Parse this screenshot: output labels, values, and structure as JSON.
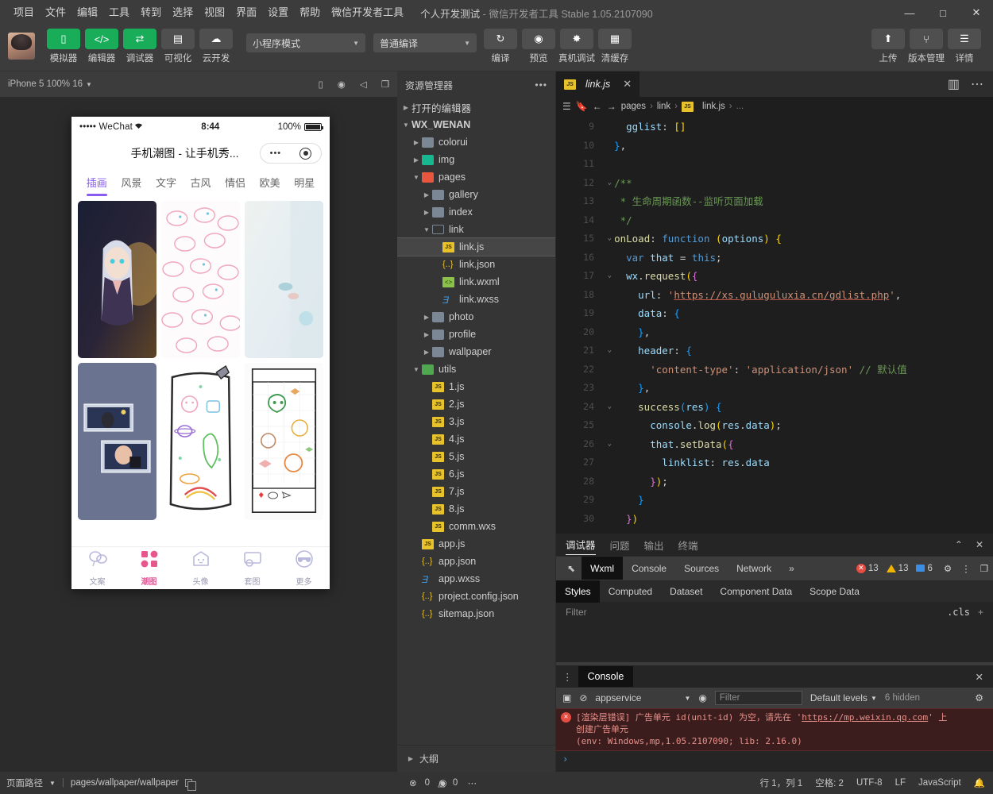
{
  "titlebar": {
    "menus": [
      "项目",
      "文件",
      "编辑",
      "工具",
      "转到",
      "选择",
      "视图",
      "界面",
      "设置",
      "帮助",
      "微信开发者工具"
    ],
    "project": "个人开发测试",
    "dash": "-",
    "app": "微信开发者工具",
    "version": "Stable 1.05.2107090",
    "minimize": "—",
    "maximize": "□",
    "close": "✕"
  },
  "toolbar": {
    "buttons": [
      {
        "label": "模拟器",
        "icon": "phone-icon",
        "style": "green"
      },
      {
        "label": "编辑器",
        "icon": "code-icon",
        "style": "green"
      },
      {
        "label": "调试器",
        "icon": "sliders-icon",
        "style": "green"
      },
      {
        "label": "可视化",
        "icon": "layout-icon",
        "style": "grey"
      },
      {
        "label": "云开发",
        "icon": "cloud-icon",
        "style": "grey"
      }
    ],
    "mode_select": "小程序模式",
    "compile_select": "普通编译",
    "actions": [
      {
        "label": "编译",
        "icon": "refresh-icon"
      },
      {
        "label": "预览",
        "icon": "eye-icon"
      },
      {
        "label": "真机调试",
        "icon": "bug-icon"
      },
      {
        "label": "清缓存",
        "icon": "layers-icon"
      }
    ],
    "right_actions": [
      {
        "label": "上传",
        "icon": "upload-icon"
      },
      {
        "label": "版本管理",
        "icon": "branch-icon"
      },
      {
        "label": "详情",
        "icon": "menu-icon"
      }
    ]
  },
  "simbar": {
    "device": "iPhone 5 100% 16",
    "icons": [
      "phone-rotate-icon",
      "record-icon",
      "volume-icon",
      "window-icon"
    ]
  },
  "editor_icons": [
    "copy-icon",
    "search-icon",
    "branch-icon",
    "extensions-icon",
    "debug-icon",
    "collapse-icon"
  ],
  "phone": {
    "carrier": "••••• WeChat",
    "wifi": "⌃",
    "time": "8:44",
    "percent": "100%",
    "nav_title": "手机潮图 - 让手机秀...",
    "capsule_dots": "•••",
    "tabs": [
      "插画",
      "风景",
      "文字",
      "古风",
      "情侣",
      "欧美",
      "明星"
    ],
    "active_tab": "插画",
    "tabbar": [
      {
        "label": "文案",
        "icon": "balloon-icon",
        "active": false
      },
      {
        "label": "潮图",
        "icon": "grid-icon",
        "active": true
      },
      {
        "label": "头像",
        "icon": "ghost-icon",
        "active": false
      },
      {
        "label": "套图",
        "icon": "album-icon",
        "active": false
      },
      {
        "label": "更多",
        "icon": "sunglasses-icon",
        "active": false
      }
    ]
  },
  "explorer": {
    "title": "资源管理器",
    "more": "•••",
    "open_editors": "打开的编辑器",
    "root": "WX_WENAN",
    "outline": "大纲",
    "tree": [
      {
        "name": "colorui",
        "type": "folder",
        "depth": 1,
        "expanded": false
      },
      {
        "name": "img",
        "type": "folder-img",
        "depth": 1,
        "expanded": false
      },
      {
        "name": "pages",
        "type": "folder-pages",
        "depth": 1,
        "expanded": true
      },
      {
        "name": "gallery",
        "type": "folder",
        "depth": 2,
        "expanded": false
      },
      {
        "name": "index",
        "type": "folder",
        "depth": 2,
        "expanded": false
      },
      {
        "name": "link",
        "type": "folder-open",
        "depth": 2,
        "expanded": true
      },
      {
        "name": "link.js",
        "type": "js",
        "depth": 3,
        "selected": true
      },
      {
        "name": "link.json",
        "type": "json",
        "depth": 3
      },
      {
        "name": "link.wxml",
        "type": "wxml",
        "depth": 3
      },
      {
        "name": "link.wxss",
        "type": "wxss",
        "depth": 3
      },
      {
        "name": "photo",
        "type": "folder",
        "depth": 2,
        "expanded": false
      },
      {
        "name": "profile",
        "type": "folder",
        "depth": 2,
        "expanded": false
      },
      {
        "name": "wallpaper",
        "type": "folder",
        "depth": 2,
        "expanded": false
      },
      {
        "name": "utils",
        "type": "folder-utils",
        "depth": 1,
        "expanded": true
      },
      {
        "name": "1.js",
        "type": "js",
        "depth": 2
      },
      {
        "name": "2.js",
        "type": "js",
        "depth": 2
      },
      {
        "name": "3.js",
        "type": "js",
        "depth": 2
      },
      {
        "name": "4.js",
        "type": "js",
        "depth": 2
      },
      {
        "name": "5.js",
        "type": "js",
        "depth": 2
      },
      {
        "name": "6.js",
        "type": "js",
        "depth": 2
      },
      {
        "name": "7.js",
        "type": "js",
        "depth": 2
      },
      {
        "name": "8.js",
        "type": "js",
        "depth": 2
      },
      {
        "name": "comm.wxs",
        "type": "js",
        "depth": 2
      },
      {
        "name": "app.js",
        "type": "js",
        "depth": 1
      },
      {
        "name": "app.json",
        "type": "json",
        "depth": 1
      },
      {
        "name": "app.wxss",
        "type": "wxss",
        "depth": 1
      },
      {
        "name": "project.config.json",
        "type": "json",
        "depth": 1
      },
      {
        "name": "sitemap.json",
        "type": "json",
        "depth": 1
      }
    ]
  },
  "editor": {
    "tab_label": "link.js",
    "tab_close": "✕",
    "breadcrumb": [
      "pages",
      "link",
      "link.js",
      "..."
    ],
    "right_icons": [
      "split-editor-icon",
      "more-actions-icon"
    ],
    "first_line_number": 9,
    "lines": [
      {
        "num": 9,
        "fold": false,
        "html": "    <span class='k-key'>gglist</span><span class='k-plain'>: </span><span class='k-br'>[]</span>"
      },
      {
        "num": 10,
        "fold": false,
        "html": "  <span class='k-br3'>}</span><span class='k-plain'>,</span>"
      },
      {
        "num": 11,
        "fold": false,
        "html": ""
      },
      {
        "num": 12,
        "fold": true,
        "html": "  <span class='k-com'>/**</span>"
      },
      {
        "num": 13,
        "fold": false,
        "html": "  <span class='k-com'> * 生命周期函数--监听页面加载</span>"
      },
      {
        "num": 14,
        "fold": false,
        "html": "  <span class='k-com'> */</span>"
      },
      {
        "num": 15,
        "fold": true,
        "html": "  <span class='k-fn'>onLoad</span><span class='k-plain'>: </span><span class='k-blue'>function</span> <span class='k-br'>(</span><span class='k-param'>options</span><span class='k-br'>)</span> <span class='k-br'>{</span>"
      },
      {
        "num": 16,
        "fold": false,
        "html": "    <span class='k-blue'>var</span> <span class='k-key'>that</span> <span class='k-plain'>=</span> <span class='k-blue'>this</span><span class='k-plain'>;</span>"
      },
      {
        "num": 17,
        "fold": true,
        "html": "    <span class='k-key'>wx</span><span class='k-plain'>.</span><span class='k-fn'>request</span><span class='k-br'>(</span><span class='k-br2'>{</span>"
      },
      {
        "num": 18,
        "fold": false,
        "html": "      <span class='k-key'>url</span><span class='k-plain'>: </span><span class='k-str'>'</span><span class='k-url'>https://xs.guluguluxia.cn/gdlist.php</span><span class='k-str'>'</span><span class='k-plain'>,</span>"
      },
      {
        "num": 19,
        "fold": false,
        "html": "      <span class='k-key'>data</span><span class='k-plain'>: </span><span class='k-br3'>{</span>"
      },
      {
        "num": 20,
        "fold": false,
        "html": "      <span class='k-br3'>}</span><span class='k-plain'>,</span>"
      },
      {
        "num": 21,
        "fold": true,
        "html": "      <span class='k-key'>header</span><span class='k-plain'>: </span><span class='k-br3'>{</span>"
      },
      {
        "num": 22,
        "fold": false,
        "html": "        <span class='k-str'>'content-type'</span><span class='k-plain'>: </span><span class='k-str'>'application/json'</span> <span class='k-com'>// 默认值</span>"
      },
      {
        "num": 23,
        "fold": false,
        "html": "      <span class='k-br3'>}</span><span class='k-plain'>,</span>"
      },
      {
        "num": 24,
        "fold": true,
        "html": "      <span class='k-fn'>success</span><span class='k-br3'>(</span><span class='k-param'>res</span><span class='k-br3'>)</span> <span class='k-br3'>{</span>"
      },
      {
        "num": 25,
        "fold": false,
        "html": "        <span class='k-key'>console</span><span class='k-plain'>.</span><span class='k-fn'>log</span><span class='k-br'>(</span><span class='k-key'>res</span><span class='k-plain'>.</span><span class='k-key'>data</span><span class='k-br'>)</span><span class='k-plain'>;</span>"
      },
      {
        "num": 26,
        "fold": true,
        "html": "        <span class='k-key'>that</span><span class='k-plain'>.</span><span class='k-fn'>setData</span><span class='k-br'>(</span><span class='k-br2'>{</span>"
      },
      {
        "num": 27,
        "fold": false,
        "html": "          <span class='k-key'>linklist</span><span class='k-plain'>: </span><span class='k-key'>res</span><span class='k-plain'>.</span><span class='k-key'>data</span>"
      },
      {
        "num": 28,
        "fold": false,
        "html": "        <span class='k-br2'>}</span><span class='k-br'>)</span><span class='k-plain'>;</span>"
      },
      {
        "num": 29,
        "fold": false,
        "html": "      <span class='k-br3'>}</span>"
      },
      {
        "num": 30,
        "fold": false,
        "html": "    <span class='k-br2'>}</span><span class='k-br'>)</span>"
      }
    ]
  },
  "debugger": {
    "panel_tabs": [
      "调试器",
      "问题",
      "输出",
      "终端"
    ],
    "active_panel_tab": "调试器",
    "collapse": "⌃",
    "close": "✕",
    "devtools_tabs": [
      "Wxml",
      "Console",
      "Sources",
      "Network"
    ],
    "active_devtools_tab": "Wxml",
    "overflow": "»",
    "errors": "13",
    "warnings": "13",
    "infos": "6",
    "styles_tabs": [
      "Styles",
      "Computed",
      "Dataset",
      "Component Data",
      "Scope Data"
    ],
    "active_styles_tab": "Styles",
    "filter_placeholder": "Filter",
    "cls": ".cls",
    "plus": "+"
  },
  "console": {
    "kebab": "⋮",
    "title": "Console",
    "close": "✕",
    "context": "appservice",
    "filter_placeholder": "Filter",
    "levels": "Default levels",
    "hidden": "6 hidden",
    "error_prefix": "[渲染层错误] 广告单元 id(unit-id) 为空，请先在 '",
    "error_link": "https://mp.weixin.qq.com",
    "error_suffix": "' 上",
    "error_line2": "创建广告单元",
    "error_env": "(env: Windows,mp,1.05.2107090; lib: 2.16.0)",
    "prompt": "›"
  },
  "status": {
    "page_path_label": "页面路径",
    "page_path": "pages/wallpaper/wallpaper",
    "outline_label": "大纲",
    "problem_errors": "0",
    "problem_warnings": "0",
    "cursor": "行 1，列 1",
    "indent": "空格: 2",
    "encoding": "UTF-8",
    "eol": "LF",
    "language": "JavaScript",
    "bell": "bell-icon"
  }
}
